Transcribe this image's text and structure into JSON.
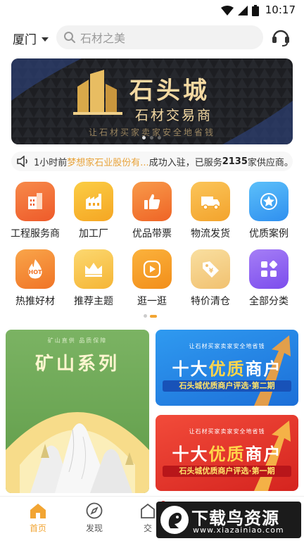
{
  "status": {
    "time": "10:17"
  },
  "header": {
    "city": "厦门",
    "search_placeholder": "石材之美"
  },
  "banner": {
    "brand": "石头城",
    "subtitle": "石材交易商",
    "slogan": "让石材买家卖家安全地省钱",
    "colors": {
      "background": "#1d1e22",
      "gold": "#f4d9a2"
    }
  },
  "notice": {
    "time": "1小时前",
    "company": "梦想家石业股份有...",
    "text_mid": "成功入驻，已服务",
    "count": "2135",
    "text_end": "家供应商。"
  },
  "categories": [
    {
      "label": "工程服务商",
      "icon": "building-icon",
      "color": "#f06a35"
    },
    {
      "label": "加工厂",
      "icon": "factory-icon",
      "color": "#f7b731"
    },
    {
      "label": "优品带票",
      "icon": "thumbs-up-icon",
      "color": "#f37a2f"
    },
    {
      "label": "物流发货",
      "icon": "truck-icon",
      "color": "#f6b43a"
    },
    {
      "label": "优质案例",
      "icon": "star-icon",
      "color": "#3fa6f2"
    },
    {
      "label": "热推好材",
      "icon": "hot-icon",
      "color": "#f38a2c"
    },
    {
      "label": "推荐主题",
      "icon": "crown-icon",
      "color": "#f7c24a"
    },
    {
      "label": "逛一逛",
      "icon": "play-icon",
      "color": "#f5a024"
    },
    {
      "label": "特价清仓",
      "icon": "price-tag-icon",
      "color": "#f4cc7a"
    },
    {
      "label": "全部分类",
      "icon": "grid-icon",
      "color": "#8a5cf0"
    }
  ],
  "promo": {
    "left": {
      "small": "矿山直供 品质保障",
      "title": "矿山系列"
    },
    "right": [
      {
        "small": "让石材买家卖家安全地省钱",
        "title_a": "十大",
        "title_b": "优质",
        "title_c": "商户",
        "strip": "石头城优质商户评选·第二期"
      },
      {
        "small": "让石材买家卖家安全地省钱",
        "title_a": "十大",
        "title_b": "优质",
        "title_c": "商户",
        "strip": "石头城优质商户评选·第一期"
      }
    ]
  },
  "tabs": [
    {
      "label": "首页",
      "icon": "home-icon",
      "active": true
    },
    {
      "label": "发现",
      "icon": "compass-icon",
      "active": false
    },
    {
      "label": "交",
      "icon": "trade-icon",
      "active": false
    }
  ],
  "watermark": {
    "title": "下载鸟资源",
    "url": "www.xiazainiao.com"
  },
  "accent": "#f2a533"
}
